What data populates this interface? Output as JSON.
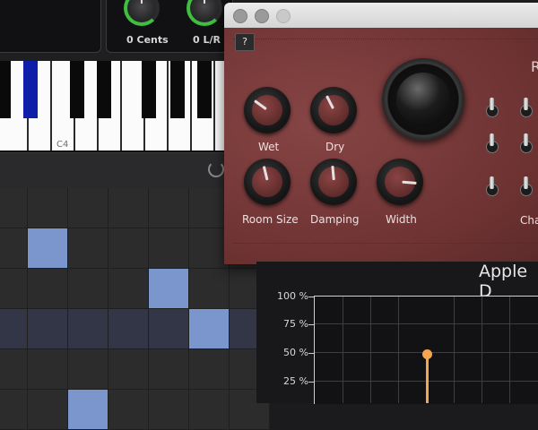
{
  "top_controls": {
    "cents_value": "0",
    "cents_unit": "Cents",
    "pan_value": "0",
    "pan_unit": "L/R"
  },
  "piano": {
    "octave_label": "C4"
  },
  "reverb_plugin": {
    "help_label": "?",
    "title_partial": "R",
    "knobs": [
      {
        "label": "Wet",
        "level": 0.3
      },
      {
        "label": "Dry",
        "level": 0.4
      },
      {
        "label": "Room Size",
        "level": 0.45
      },
      {
        "label": "Damping",
        "level": 0.48
      },
      {
        "label": "Width",
        "level": 0.85
      }
    ],
    "side_label_partial": "Cha"
  },
  "graph": {
    "title_partial": "Apple D",
    "y_labels": [
      "100 %",
      "75 %",
      "50 %",
      "25 %"
    ],
    "marker_value_percent": 50
  },
  "colors": {
    "accent_green": "#3fbf3f",
    "active_key": "#0d1fa8",
    "plugin_red": "#7b3a3a",
    "graph_marker": "#f2a650",
    "grid_highlight": "#7a96cc"
  }
}
